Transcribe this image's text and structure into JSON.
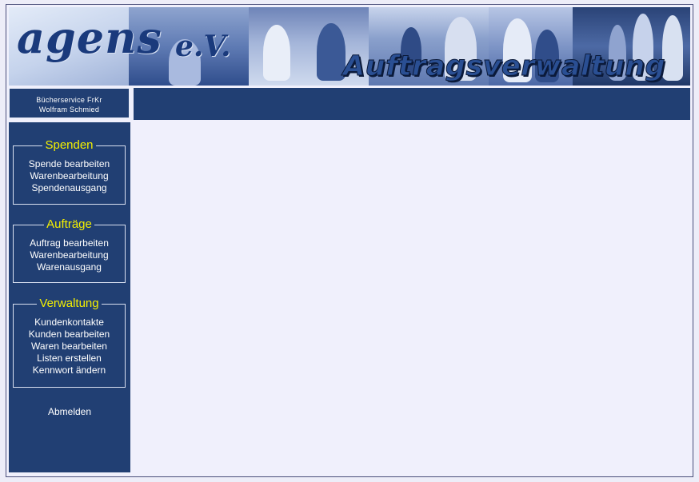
{
  "banner": {
    "logo_text": "agens",
    "logo_suffix": "e.V.",
    "title": "Auftragsverwaltung"
  },
  "account": {
    "line1": "Bücherservice FrKr",
    "line2": "Wolfram Schmied"
  },
  "menu": {
    "groups": [
      {
        "title": "Spenden",
        "items": [
          "Spende bearbeiten",
          "Warenbearbeitung",
          "Spendenausgang"
        ]
      },
      {
        "title": "Aufträge",
        "items": [
          "Auftrag bearbeiten",
          "Warenbearbeitung",
          "Warenausgang"
        ]
      },
      {
        "title": "Verwaltung",
        "items": [
          "Kundenkontakte",
          "Kunden bearbeiten",
          "Waren bearbeiten",
          "Listen erstellen",
          "Kennwort ändern"
        ]
      }
    ],
    "logout": "Abmelden"
  },
  "colors": {
    "nav_background": "#213f73",
    "group_title": "#f4f000",
    "content_background": "#f0f0fc"
  }
}
